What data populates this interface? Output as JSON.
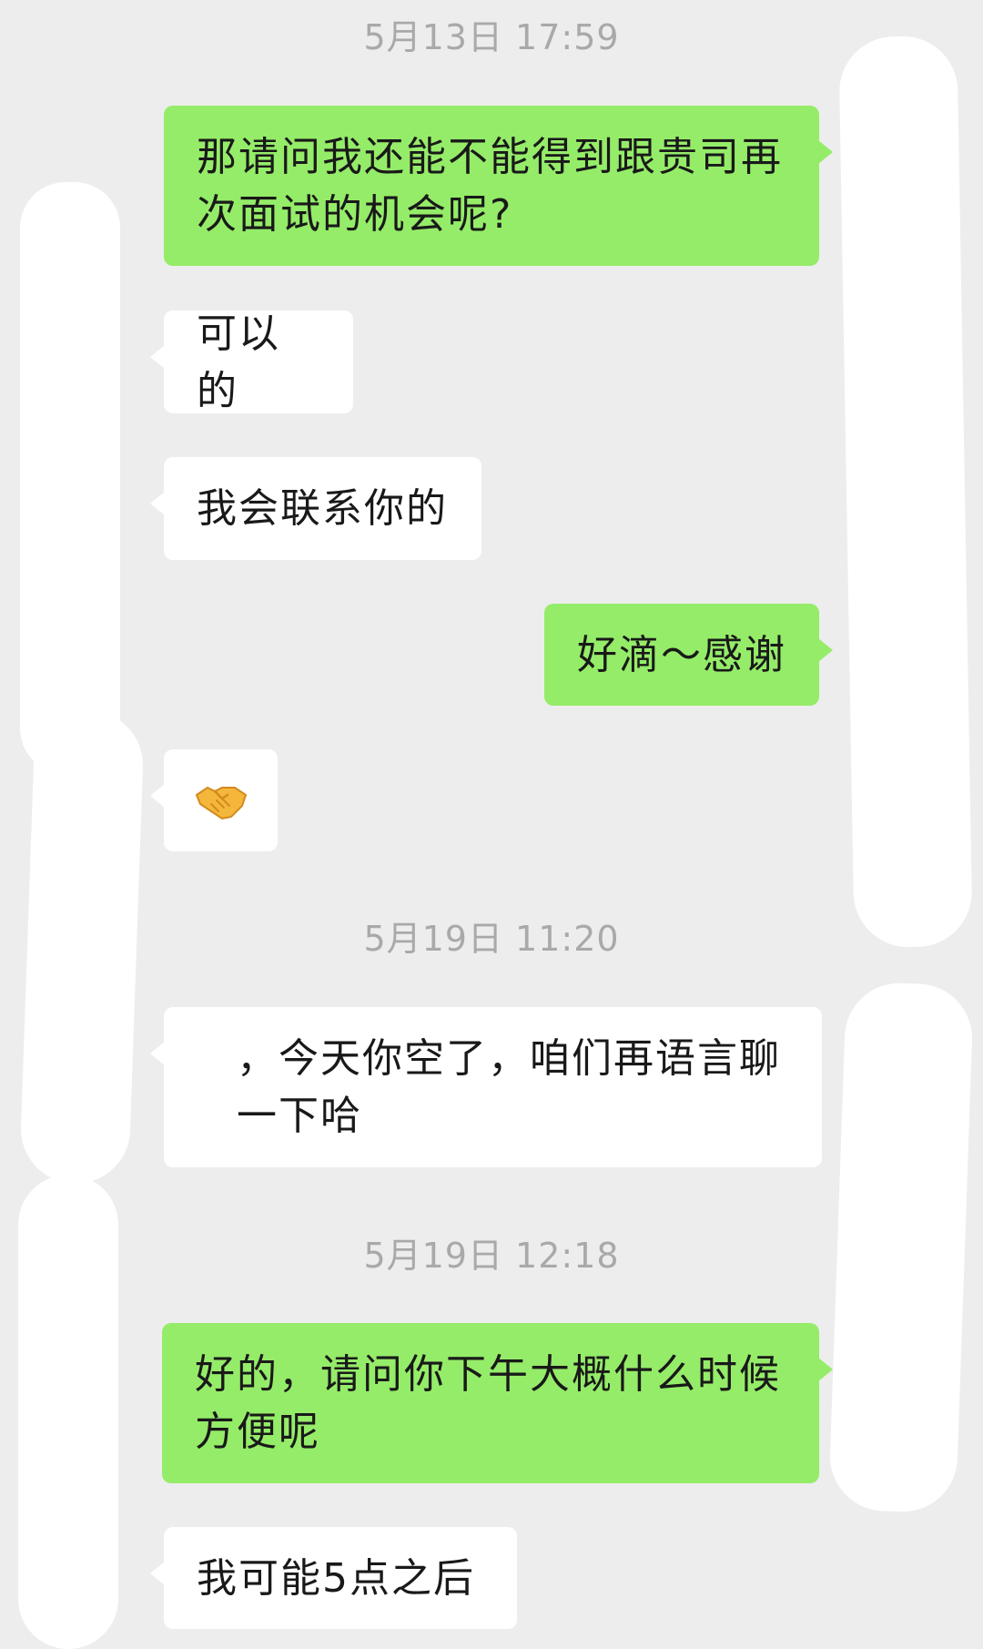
{
  "chat": {
    "timestamps": [
      "5月13日 17:59",
      "5月19日 11:20",
      "5月19日 12:18"
    ],
    "messages": [
      {
        "sender": "me",
        "text": "那请问我还能不能得到跟贵司再次面试的机会呢?"
      },
      {
        "sender": "other",
        "text": "可以的"
      },
      {
        "sender": "other",
        "text": "我会联系你的"
      },
      {
        "sender": "me",
        "text": "好滴～感谢"
      },
      {
        "sender": "other",
        "icon": "handshake-icon"
      },
      {
        "sender": "other",
        "text": "，今天你空了，咱们再语言聊一下哈"
      },
      {
        "sender": "me",
        "text": "好的，请问你下午大概什么时候方便呢"
      },
      {
        "sender": "other",
        "text": "我可能5点之后"
      }
    ]
  },
  "colors": {
    "background": "#ededed",
    "my_bubble": "#95ec69",
    "their_bubble": "#ffffff",
    "timestamp_text": "#a9a9a9"
  }
}
